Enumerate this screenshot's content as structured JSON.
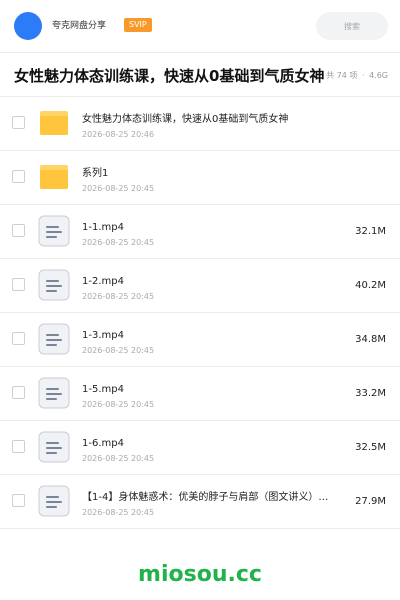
{
  "header": {
    "share_name": "夸克网盘分享",
    "badge": "SVIP",
    "search_placeholder": "搜索",
    "avatar_color": "#2b7cf6",
    "badge_color": "#f79a2b"
  },
  "folder": {
    "title": "女性魅力体态训练课，快速从0基础到气质女神",
    "item_count": "共 74 项",
    "separator": "·",
    "total_size": "4.6G"
  },
  "files": [
    {
      "type": "folder",
      "icon": "folder-icon",
      "name": "女性魅力体态训练课，快速从0基础到气质女神",
      "date": "2026-08-25 20:46",
      "size": ""
    },
    {
      "type": "folder",
      "icon": "folder-icon",
      "name": "系列1",
      "date": "2026-08-25 20:45",
      "size": ""
    },
    {
      "type": "file",
      "icon": "document-icon",
      "name": "1-1.mp4",
      "date": "2026-08-25 20:45",
      "size": "32.1M"
    },
    {
      "type": "file",
      "icon": "document-icon",
      "name": "1-2.mp4",
      "date": "2026-08-25 20:45",
      "size": "40.2M"
    },
    {
      "type": "file",
      "icon": "document-icon",
      "name": "1-3.mp4",
      "date": "2026-08-25 20:45",
      "size": "34.8M"
    },
    {
      "type": "file",
      "icon": "document-icon",
      "name": "1-5.mp4",
      "date": "2026-08-25 20:45",
      "size": "33.2M"
    },
    {
      "type": "file",
      "icon": "document-icon",
      "name": "1-6.mp4",
      "date": "2026-08-25 20:45",
      "size": "32.5M"
    },
    {
      "type": "file",
      "icon": "document-icon",
      "name": "【1-4】身体魅惑术：优美的脖子与肩部（图文讲义）…",
      "date": "2026-08-25 20:45",
      "size": "27.9M"
    }
  ],
  "watermark": "miosou.cc",
  "colors": {
    "folder": "#ffc53d",
    "folder_tab": "#ffd666",
    "document_bg": "#f0f2f5",
    "document_lines": "#7a8599",
    "watermark": "#21b24a"
  }
}
